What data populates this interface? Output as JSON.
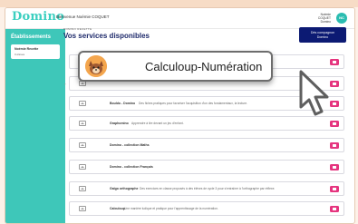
{
  "app": {
    "logo": "Domino",
    "welcome": "Bienvenue Noémie COQUET",
    "user_lines": [
      "Noémie",
      "COQUET",
      "Domino"
    ],
    "avatar_initials": "NC"
  },
  "sidebar": {
    "title": "Établissements",
    "card_name": "Noémie Recette",
    "card_sub": "0 élèves"
  },
  "main": {
    "breadcrumb": "DOMINO RECETTE",
    "title": "Vos services disponibles",
    "cta_line1": "Dès compagnon",
    "cta_line2": "Domino",
    "stray_text": "T",
    "rows": [
      {
        "title": "",
        "desc": ""
      },
      {
        "title": "",
        "desc": ""
      },
      {
        "title": "Bouldo - Domino",
        "desc": "Des fiches pratiques pour favoriser l'acquisition d'un des fondamentaux, la lecture."
      },
      {
        "title": "Graphomino",
        "desc": "Apprendre à lire devant un jeu d'enfant."
      },
      {
        "title": "Domino - collection Maths",
        "desc": ""
      },
      {
        "title": "Domino - collection Français",
        "desc": ""
      },
      {
        "title": "Galgo orthographe",
        "desc": "Des exercices en classe proposés à des élèves de cycle 3 pour s'entraîner à l'orthographe par réflexe."
      },
      {
        "title": "Calculoup",
        "desc": "Une manière ludique et pratique pour l'apprentissage de la numération."
      }
    ]
  },
  "popup": {
    "label": "Calculoup-Numération"
  },
  "colors": {
    "teal": "#3ec7b9",
    "navy": "#0c1a73",
    "pink": "#e5357f",
    "popup_border": "#6d6d6d"
  }
}
